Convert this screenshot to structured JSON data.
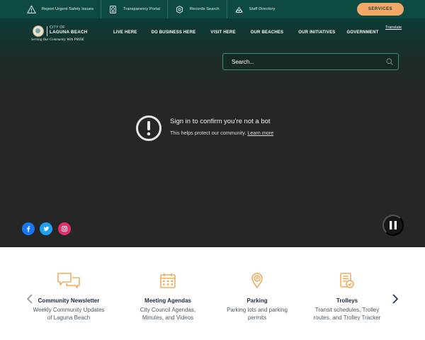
{
  "topbar": {
    "links": [
      {
        "label": "Report Urgent Safety Issues",
        "icon": "warning-triangle-icon"
      },
      {
        "label": "Transparency Portal",
        "icon": "transparency-icon"
      },
      {
        "label": "Records Search",
        "icon": "records-icon"
      },
      {
        "label": "Staff Directory",
        "icon": "staff-icon"
      }
    ],
    "services_label": "SERVICES"
  },
  "header": {
    "logo": {
      "city_of": "CITY OF",
      "name": "LAGUNA BEACH",
      "tagline": "Serving Our Community With PRIDE"
    },
    "nav": [
      "LIVE HERE",
      "DO BUSINESS HERE",
      "VISIT HERE",
      "OUR BEACHES",
      "OUR INITIATIVES",
      "GOVERNMENT"
    ],
    "translate_label": "Translate"
  },
  "search": {
    "placeholder": "Search..."
  },
  "bot_check": {
    "title": "Sign in to confirm you’re not a bot",
    "subtitle": "This helps protect our community.",
    "link": "Learn more"
  },
  "social": [
    {
      "name": "facebook",
      "icon": "facebook-icon",
      "color": "#1877f2"
    },
    {
      "name": "twitter",
      "icon": "twitter-icon",
      "color": "#1da1f2"
    },
    {
      "name": "instagram",
      "icon": "instagram-icon",
      "color": "#e1306c"
    }
  ],
  "quick_links": [
    {
      "title": "Community Newsletter",
      "desc": "Weekly Community Updates of Laguna Beach",
      "icon": "newsletter-icon"
    },
    {
      "title": "Meeting Agendas",
      "desc": "City Council Agendas, Minutes, and Videos",
      "icon": "calendar-icon"
    },
    {
      "title": "Parking",
      "desc": "Parking lots and parking permits",
      "icon": "parking-icon"
    },
    {
      "title": "Trolleys",
      "desc": "Transit schedules, Trolley routes, and Trolley Tracker",
      "icon": "trolley-icon"
    }
  ],
  "colors": {
    "topbar_bg": "#0d4a42",
    "services_btn": "#f4a867",
    "icon_accent": "#f29a3c",
    "hero_bg": "#262626",
    "search_border": "#3f8f84"
  }
}
